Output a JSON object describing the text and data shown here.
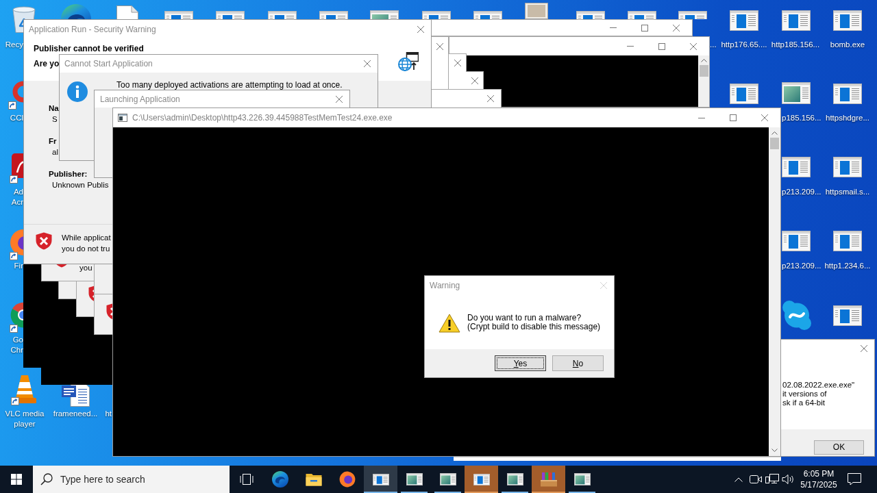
{
  "desktop_icons": [
    {
      "kind": "recycle-bin",
      "label": "Recy"
    },
    {
      "kind": "swirl-logo"
    },
    {
      "kind": "document"
    },
    {
      "kind": "app-window"
    },
    {
      "kind": "app-window"
    },
    {
      "kind": "app-window"
    },
    {
      "kind": "app-window"
    },
    {
      "kind": "picture-window"
    },
    {
      "kind": "app-window"
    },
    {
      "kind": "app-window"
    },
    {
      "kind": "photo"
    },
    {
      "kind": "app-window"
    },
    {
      "kind": "app-window"
    },
    {
      "kind": "app-window",
      "label": "..."
    },
    {
      "kind": "app-window",
      "label": "http176.65...."
    },
    {
      "kind": "app-window",
      "label": "http185.156..."
    },
    {
      "kind": "app-window",
      "label": "bomb.exe"
    },
    {
      "kind": "ring-logo",
      "label": "CCl"
    },
    {
      "kind": "app-window"
    },
    {
      "kind": "picture-window",
      "label": "p185.156..."
    },
    {
      "kind": "app-window",
      "label": "httpshdgre..."
    },
    {
      "kind": "app-tile",
      "label": "Ad Acr"
    },
    {
      "kind": "app-window",
      "label": "p213.209..."
    },
    {
      "kind": "app-window",
      "label": "httpsmail.s..."
    },
    {
      "kind": "round-logo",
      "label": "Fir"
    },
    {
      "kind": "app-window",
      "label": "p213.209..."
    },
    {
      "kind": "app-window",
      "label": "http1.234.6..."
    },
    {
      "kind": "segmented-logo",
      "label": "Go Chr"
    },
    {
      "kind": "chat-logo"
    },
    {
      "kind": "app-window"
    },
    {
      "kind": "traffic-cone",
      "label": "VLC media player"
    },
    {
      "kind": "word-document",
      "label": "frameneed..."
    },
    {
      "label": "ht"
    }
  ],
  "background_dialog": {
    "text": "you"
  },
  "security_warning": {
    "title": "Application Run - Security Warning",
    "heading": "Publisher cannot be verified",
    "question": "Are yo",
    "fields": [
      {
        "label": "Na",
        "value": "S"
      },
      {
        "label": "Fr",
        "value": "al"
      },
      {
        "label": "Publisher:",
        "value": "Unknown Publis"
      }
    ],
    "notice": "While applicat\nyou do not tru"
  },
  "cannot_start_dialog": {
    "title": "Cannot Start Application",
    "message": "Too many deployed activations are attempting to load at once."
  },
  "launching_dialog": {
    "title": "Launching Application"
  },
  "error_dialog": {
    "message": "02.08.2022.exe.exe\"\nit versions of\nsk if a 64-bit",
    "button": "OK"
  },
  "console_window": {
    "title": "C:\\Users\\admin\\Desktop\\http43.226.39.445988TestMemTest24.exe.exe"
  },
  "warning_dialog": {
    "title": "Warning",
    "close_disabled": true,
    "message": "Do you want to run a malware?\n(Crypt build to disable this message)",
    "buttons": [
      {
        "label": "Yes",
        "focused": true
      },
      {
        "label": "No",
        "focused": false
      }
    ]
  },
  "taskbar": {
    "search": {
      "placeholder": "Type here to search"
    },
    "apps": [
      {
        "kind": "task-view"
      },
      {
        "kind": "swirl-logo",
        "running": false,
        "active": false,
        "flashing": false
      },
      {
        "kind": "folder",
        "running": false,
        "active": false,
        "flashing": false
      },
      {
        "kind": "round-logo",
        "running": false,
        "active": false,
        "flashing": false
      },
      {
        "kind": "app-window",
        "running": true,
        "active": true,
        "flashing": false
      },
      {
        "kind": "picture-window",
        "running": true,
        "active": false,
        "flashing": false
      },
      {
        "kind": "picture-window",
        "running": true,
        "active": false,
        "flashing": false
      },
      {
        "kind": "app-window",
        "running": true,
        "active": false,
        "flashing": true
      },
      {
        "kind": "picture-window",
        "running": true,
        "active": false,
        "flashing": false
      },
      {
        "kind": "archive",
        "running": true,
        "active": false,
        "flashing": true
      },
      {
        "kind": "picture-window",
        "running": true,
        "active": false,
        "flashing": false
      }
    ],
    "clock": {
      "time": "6:05 PM",
      "date": "5/17/2025"
    }
  }
}
